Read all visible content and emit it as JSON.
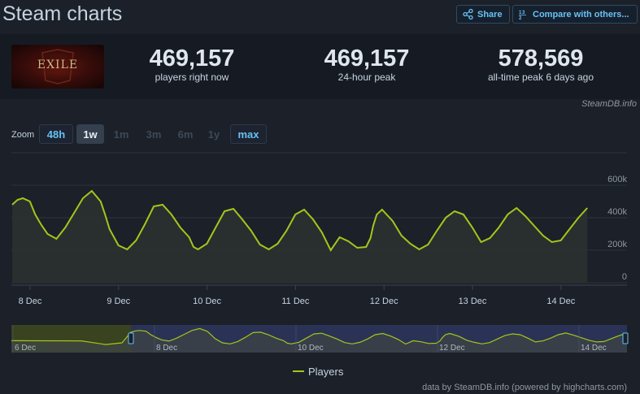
{
  "header": {
    "title": "Steam charts",
    "share_label": "Share",
    "compare_label": "Compare with others..."
  },
  "game": {
    "logo_text": "EXILE"
  },
  "stats": [
    {
      "value": "469,157",
      "label": "players right now"
    },
    {
      "value": "469,157",
      "label": "24-hour peak"
    },
    {
      "value": "578,569",
      "label": "all-time peak 6 days ago"
    }
  ],
  "credit_top": "SteamDB.info",
  "zoom": {
    "label": "Zoom",
    "options": [
      {
        "label": "48h",
        "state": "enabled"
      },
      {
        "label": "1w",
        "state": "selected"
      },
      {
        "label": "1m",
        "state": "disabled"
      },
      {
        "label": "3m",
        "state": "disabled"
      },
      {
        "label": "6m",
        "state": "disabled"
      },
      {
        "label": "1y",
        "state": "disabled"
      },
      {
        "label": "max",
        "state": "enabled"
      }
    ]
  },
  "colors": {
    "series": "#a4c61a",
    "navigator_selected": "#2a3356",
    "navigator_old": "#3a431f"
  },
  "chart_data": {
    "type": "line",
    "xlabel": "",
    "ylabel": "",
    "x_tick_labels": [
      "8 Dec",
      "9 Dec",
      "10 Dec",
      "11 Dec",
      "12 Dec",
      "13 Dec",
      "14 Dec"
    ],
    "y_ticks": [
      0,
      200000,
      400000,
      600000
    ],
    "y_tick_labels": [
      "0",
      "200k",
      "400k",
      "600k"
    ],
    "ylim": [
      0,
      800000
    ],
    "grid": true,
    "legend_position": "bottom-center",
    "series": [
      {
        "name": "Players",
        "x_days": [
          0,
          0.06,
          0.12,
          0.2,
          0.26,
          0.33,
          0.4,
          0.5,
          0.6,
          0.7,
          0.8,
          0.9,
          1.0,
          1.05,
          1.1,
          1.2,
          1.3,
          1.4,
          1.5,
          1.6,
          1.7,
          1.8,
          1.9,
          2.0,
          2.05,
          2.1,
          2.2,
          2.3,
          2.4,
          2.5,
          2.6,
          2.7,
          2.8,
          2.9,
          3.0,
          3.1,
          3.2,
          3.3,
          3.4,
          3.5,
          3.6,
          3.7,
          3.8,
          3.9,
          4.0,
          4.05,
          4.08,
          4.12,
          4.18,
          4.3,
          4.4,
          4.5,
          4.6,
          4.7,
          4.8,
          4.9,
          5.0,
          5.1,
          5.2,
          5.3,
          5.4,
          5.5,
          5.6,
          5.7,
          5.8,
          5.9,
          6.0,
          6.1,
          6.2,
          6.3,
          6.4,
          6.5
        ],
        "values": [
          480000,
          510000,
          520000,
          500000,
          420000,
          355000,
          300000,
          270000,
          340000,
          430000,
          520000,
          565000,
          500000,
          420000,
          330000,
          230000,
          205000,
          260000,
          360000,
          470000,
          480000,
          420000,
          340000,
          280000,
          220000,
          205000,
          240000,
          340000,
          440000,
          455000,
          390000,
          320000,
          235000,
          205000,
          240000,
          320000,
          420000,
          450000,
          390000,
          310000,
          200000,
          280000,
          255000,
          215000,
          220000,
          275000,
          350000,
          420000,
          450000,
          380000,
          290000,
          240000,
          205000,
          235000,
          320000,
          400000,
          440000,
          420000,
          340000,
          250000,
          275000,
          340000,
          420000,
          460000,
          410000,
          350000,
          290000,
          250000,
          260000,
          330000,
          400000,
          460000
        ]
      }
    ],
    "navigator_x_tick_labels": [
      "6 Dec",
      "8 Dec",
      "10 Dec",
      "12 Dec",
      "14 Dec"
    ]
  },
  "legend": {
    "series_label": "Players"
  },
  "footer_credit": "data by SteamDB.info (powered by highcharts.com)"
}
